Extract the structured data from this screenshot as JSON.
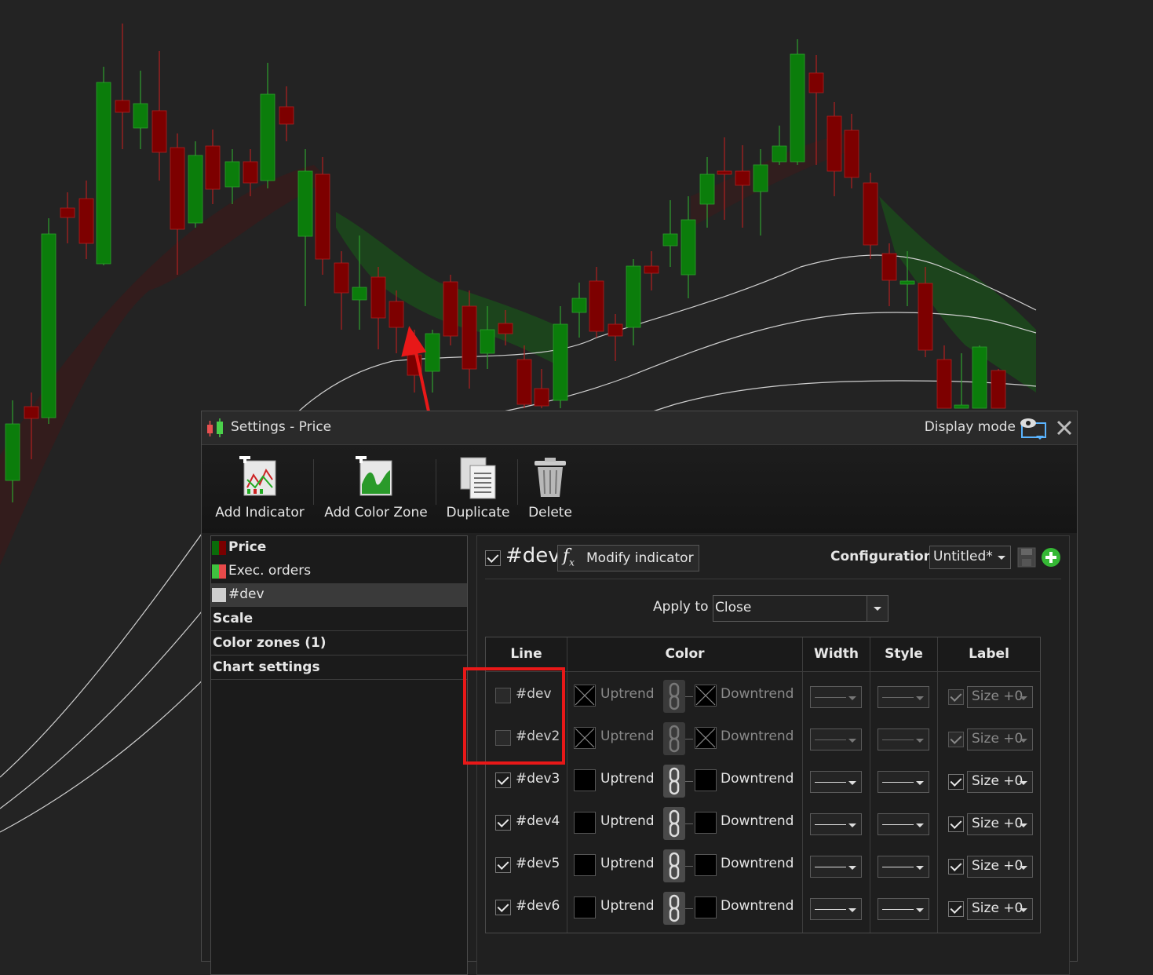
{
  "window": {
    "title": "Settings - Price",
    "display_mode": "Display mode"
  },
  "toolbar": {
    "add_indicator": "Add Indicator",
    "add_color_zone": "Add Color Zone",
    "duplicate": "Duplicate",
    "delete": "Delete"
  },
  "sidebar": {
    "items": [
      {
        "label": "Price",
        "color_a": "#0a6b0a",
        "color_b": "#7a0000"
      },
      {
        "label": "Exec. orders",
        "color_a": "#3fc23f",
        "color_b": "#e84a4a"
      },
      {
        "label": "#dev",
        "color_a": "#cfcfcf",
        "color_b": "#cfcfcf"
      }
    ],
    "sections": [
      "Scale",
      "Color zones (1)",
      "Chart settings"
    ]
  },
  "indicator": {
    "name": "#dev",
    "modify_label": "Modify indicator",
    "configuration_label": "Configuration:",
    "configuration_value": "Untitled*",
    "apply_to_label": "Apply to",
    "apply_to_value": "Close"
  },
  "table": {
    "headers": [
      "Line",
      "Color",
      "Width",
      "Style",
      "Label"
    ],
    "uptrend": "Uptrend",
    "downtrend": "Downtrend",
    "rows": [
      {
        "name": "#dev",
        "checked": false,
        "label_size": "Size +0"
      },
      {
        "name": "#dev2",
        "checked": false,
        "label_size": "Size +0"
      },
      {
        "name": "#dev3",
        "checked": true,
        "label_size": "Size +0"
      },
      {
        "name": "#dev4",
        "checked": true,
        "label_size": "Size +0"
      },
      {
        "name": "#dev5",
        "checked": true,
        "label_size": "Size +0"
      },
      {
        "name": "#dev6",
        "checked": true,
        "label_size": "Size +0"
      }
    ]
  },
  "colors": {
    "bull": "#0b7d0b",
    "bear": "#7d0000",
    "highlight": "#e81818",
    "add": "#35b835"
  }
}
